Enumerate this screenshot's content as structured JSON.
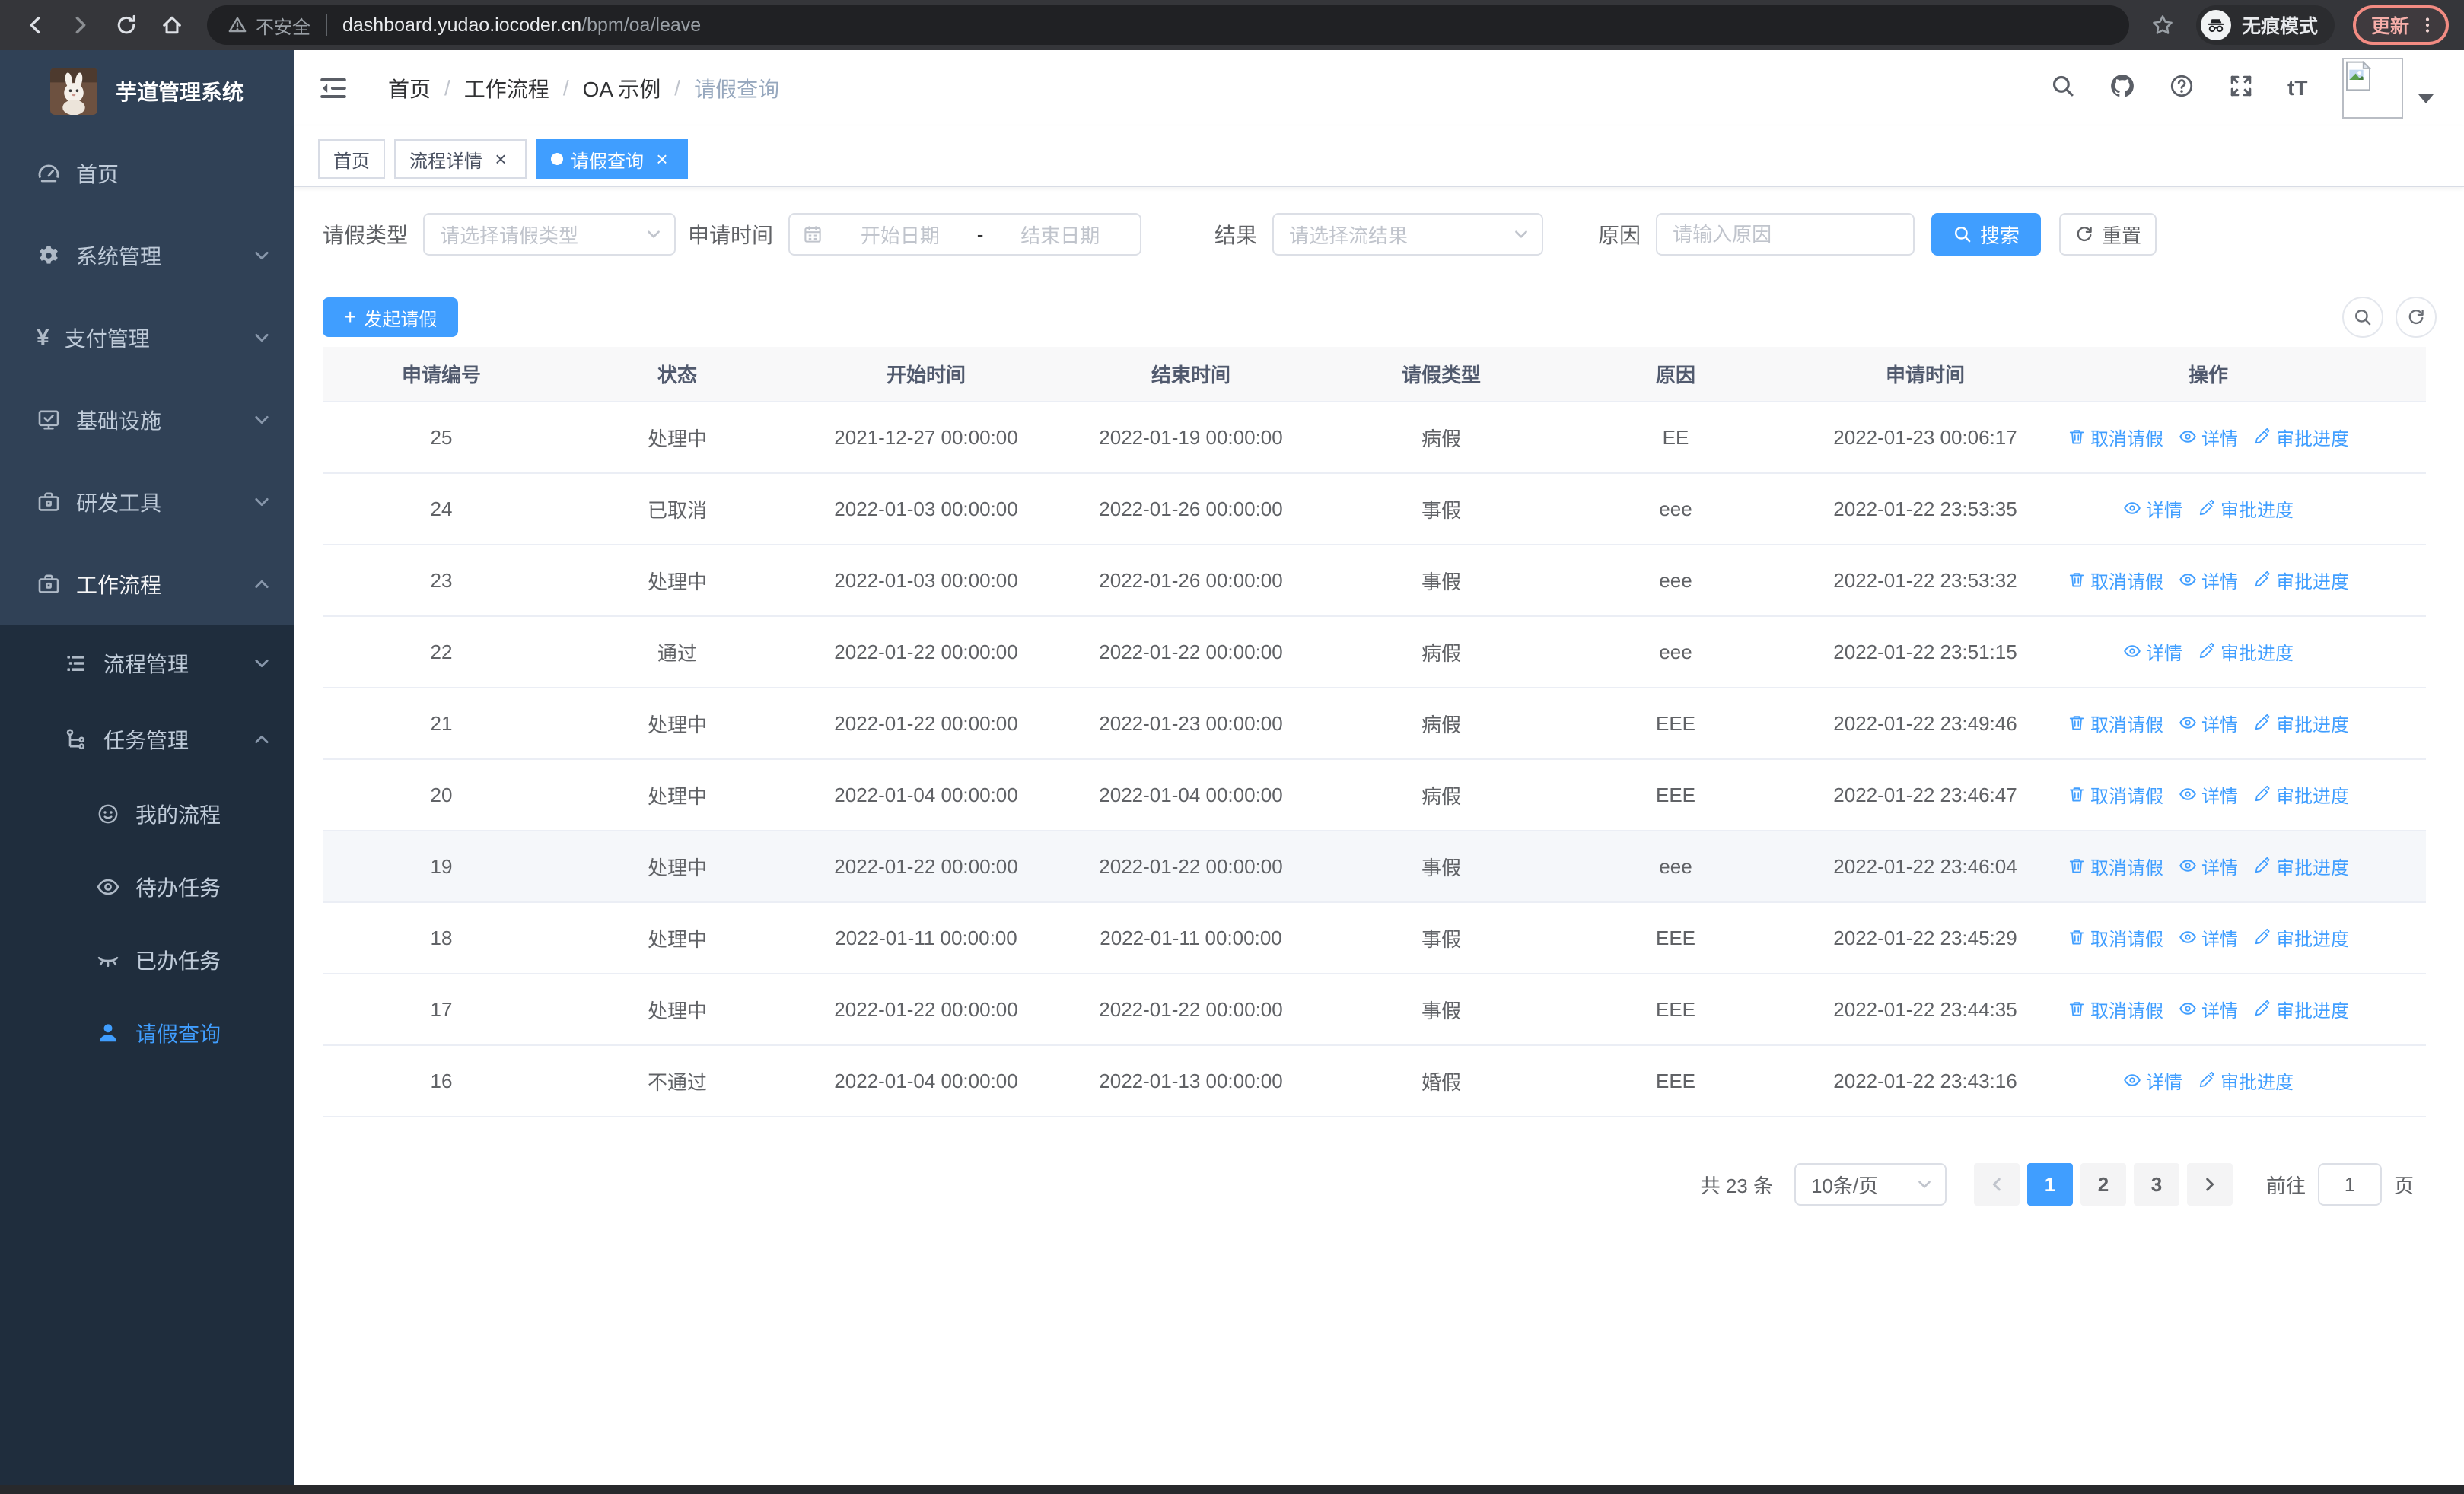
{
  "browser": {
    "nav_icons": [
      "back-icon",
      "forward-icon",
      "reload-icon",
      "home-icon"
    ],
    "security_label": "不安全",
    "url_host": "dashboard.yudao.iocoder.cn",
    "url_path": "/bpm/oa/leave",
    "incognito_label": "无痕模式",
    "update_label": "更新"
  },
  "sidebar": {
    "title": "芋道管理系统",
    "items": [
      {
        "key": "home",
        "label": "首页",
        "icon": "dashboard-icon",
        "level": 1
      },
      {
        "key": "system-mgmt",
        "label": "系统管理",
        "icon": "gear-icon",
        "level": 1,
        "chevron": "down"
      },
      {
        "key": "payment-mgmt",
        "label": "支付管理",
        "icon": "yen-icon",
        "level": 1,
        "chevron": "down"
      },
      {
        "key": "infrastructure",
        "label": "基础设施",
        "icon": "monitor-icon",
        "level": 1,
        "chevron": "down"
      },
      {
        "key": "dev-tools",
        "label": "研发工具",
        "icon": "toolbox-icon",
        "level": 1,
        "chevron": "down"
      },
      {
        "key": "workflow",
        "label": "工作流程",
        "icon": "briefcase-icon",
        "level": 1,
        "chevron": "up",
        "open": true
      },
      {
        "key": "process-mgmt",
        "label": "流程管理",
        "icon": "list-icon",
        "level": 2,
        "chevron": "down",
        "submenu": true
      },
      {
        "key": "task-mgmt",
        "label": "任务管理",
        "icon": "tree-icon",
        "level": 2,
        "chevron": "up",
        "submenu": true
      },
      {
        "key": "my-process",
        "label": "我的流程",
        "icon": "robot-icon",
        "level": 3,
        "submenu": true
      },
      {
        "key": "todo-tasks",
        "label": "待办任务",
        "icon": "eye-icon",
        "level": 3,
        "submenu": true
      },
      {
        "key": "done-tasks",
        "label": "已办任务",
        "icon": "eye-closed-icon",
        "level": 3,
        "submenu": true
      },
      {
        "key": "leave-query",
        "label": "请假查询",
        "icon": "user-icon",
        "level": 3,
        "submenu": true,
        "active": true
      }
    ]
  },
  "header": {
    "breadcrumb": [
      {
        "label": "首页",
        "muted": false
      },
      {
        "label": "工作流程",
        "muted": false
      },
      {
        "label": "OA 示例",
        "muted": false
      },
      {
        "label": "请假查询",
        "muted": true
      }
    ],
    "icons": [
      "search-icon",
      "github-icon",
      "question-icon",
      "fullscreen-icon",
      "font-size-icon"
    ]
  },
  "tabs": [
    {
      "key": "home",
      "label": "首页",
      "closable": false,
      "active": false
    },
    {
      "key": "process-detail",
      "label": "流程详情",
      "closable": true,
      "active": false
    },
    {
      "key": "leave-query",
      "label": "请假查询",
      "closable": true,
      "active": true
    }
  ],
  "filters": {
    "leave_type_label": "请假类型",
    "leave_type_placeholder": "请选择请假类型",
    "apply_time_label": "申请时间",
    "date_start_placeholder": "开始日期",
    "date_separator": "-",
    "date_end_placeholder": "结束日期",
    "result_label": "结果",
    "result_placeholder": "请选择流结果",
    "reason_label": "原因",
    "reason_placeholder": "请输入原因",
    "search_label": "搜索",
    "reset_label": "重置"
  },
  "toolbar": {
    "create_label": "发起请假"
  },
  "table": {
    "columns": [
      "申请编号",
      "状态",
      "开始时间",
      "结束时间",
      "请假类型",
      "原因",
      "申请时间",
      "操作"
    ],
    "action_defs": {
      "cancel": {
        "label": "取消请假",
        "icon": "trash-icon"
      },
      "detail": {
        "label": "详情",
        "icon": "eye-icon"
      },
      "progress": {
        "label": "审批进度",
        "icon": "pen-icon"
      }
    },
    "rows": [
      {
        "id": "25",
        "status": "处理中",
        "start": "2021-12-27 00:00:00",
        "end": "2022-01-19 00:00:00",
        "type": "病假",
        "reason": "EE",
        "applied": "2022-01-23 00:06:17",
        "actions": [
          "cancel",
          "detail",
          "progress"
        ]
      },
      {
        "id": "24",
        "status": "已取消",
        "start": "2022-01-03 00:00:00",
        "end": "2022-01-26 00:00:00",
        "type": "事假",
        "reason": "eee",
        "applied": "2022-01-22 23:53:35",
        "actions": [
          "detail",
          "progress"
        ]
      },
      {
        "id": "23",
        "status": "处理中",
        "start": "2022-01-03 00:00:00",
        "end": "2022-01-26 00:00:00",
        "type": "事假",
        "reason": "eee",
        "applied": "2022-01-22 23:53:32",
        "actions": [
          "cancel",
          "detail",
          "progress"
        ]
      },
      {
        "id": "22",
        "status": "通过",
        "start": "2022-01-22 00:00:00",
        "end": "2022-01-22 00:00:00",
        "type": "病假",
        "reason": "eee",
        "applied": "2022-01-22 23:51:15",
        "actions": [
          "detail",
          "progress"
        ]
      },
      {
        "id": "21",
        "status": "处理中",
        "start": "2022-01-22 00:00:00",
        "end": "2022-01-23 00:00:00",
        "type": "病假",
        "reason": "EEE",
        "applied": "2022-01-22 23:49:46",
        "actions": [
          "cancel",
          "detail",
          "progress"
        ]
      },
      {
        "id": "20",
        "status": "处理中",
        "start": "2022-01-04 00:00:00",
        "end": "2022-01-04 00:00:00",
        "type": "病假",
        "reason": "EEE",
        "applied": "2022-01-22 23:46:47",
        "actions": [
          "cancel",
          "detail",
          "progress"
        ]
      },
      {
        "id": "19",
        "status": "处理中",
        "start": "2022-01-22 00:00:00",
        "end": "2022-01-22 00:00:00",
        "type": "事假",
        "reason": "eee",
        "applied": "2022-01-22 23:46:04",
        "actions": [
          "cancel",
          "detail",
          "progress"
        ],
        "hover": true
      },
      {
        "id": "18",
        "status": "处理中",
        "start": "2022-01-11 00:00:00",
        "end": "2022-01-11 00:00:00",
        "type": "事假",
        "reason": "EEE",
        "applied": "2022-01-22 23:45:29",
        "actions": [
          "cancel",
          "detail",
          "progress"
        ]
      },
      {
        "id": "17",
        "status": "处理中",
        "start": "2022-01-22 00:00:00",
        "end": "2022-01-22 00:00:00",
        "type": "事假",
        "reason": "EEE",
        "applied": "2022-01-22 23:44:35",
        "actions": [
          "cancel",
          "detail",
          "progress"
        ]
      },
      {
        "id": "16",
        "status": "不通过",
        "start": "2022-01-04 00:00:00",
        "end": "2022-01-13 00:00:00",
        "type": "婚假",
        "reason": "EEE",
        "applied": "2022-01-22 23:43:16",
        "actions": [
          "detail",
          "progress"
        ]
      }
    ]
  },
  "pagination": {
    "total_label": "共 23 条",
    "page_size": "10条/页",
    "pages": [
      "1",
      "2",
      "3"
    ],
    "current_page": "1",
    "goto_label": "前往",
    "goto_value": "1",
    "page_unit": "页"
  },
  "colors": {
    "primary": "#409eff",
    "sidebar_bg": "#304156",
    "submenu_bg": "#1f2d3d"
  }
}
